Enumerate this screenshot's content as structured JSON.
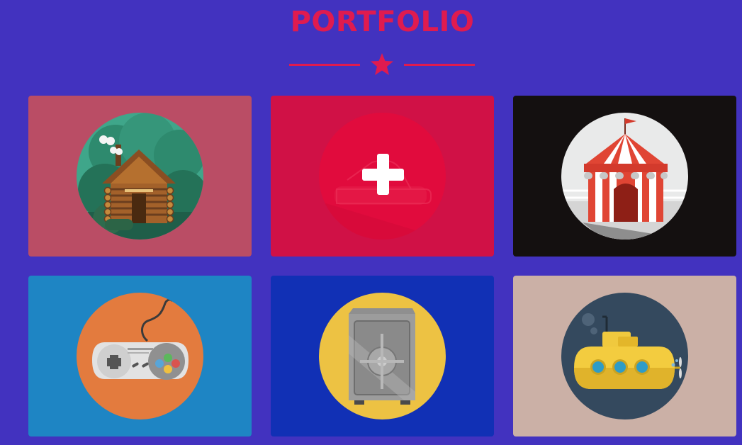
{
  "header": {
    "title": "PORTFOLIO",
    "accent_color": "#DF1B4F",
    "divider_icon": "star-icon"
  },
  "portfolio": {
    "items": [
      {
        "icon": "log-cabin-icon",
        "background": "#BA4D65",
        "circle": "#3F9A7D"
      },
      {
        "icon": "plus-icon",
        "background": "#D01146",
        "circle": "#E10B3D",
        "overlay_icon": "submarine-icon"
      },
      {
        "icon": "circus-tent-icon",
        "background": "#141010",
        "circle": "#E9E9E9"
      },
      {
        "icon": "game-controller-icon",
        "background": "#1E85C4",
        "circle": "#E37B3E"
      },
      {
        "icon": "safe-icon",
        "background": "#1130B5",
        "circle": "#EDC243"
      },
      {
        "icon": "submarine-icon",
        "background": "#CBB0A6",
        "circle": "#34495E"
      }
    ]
  }
}
